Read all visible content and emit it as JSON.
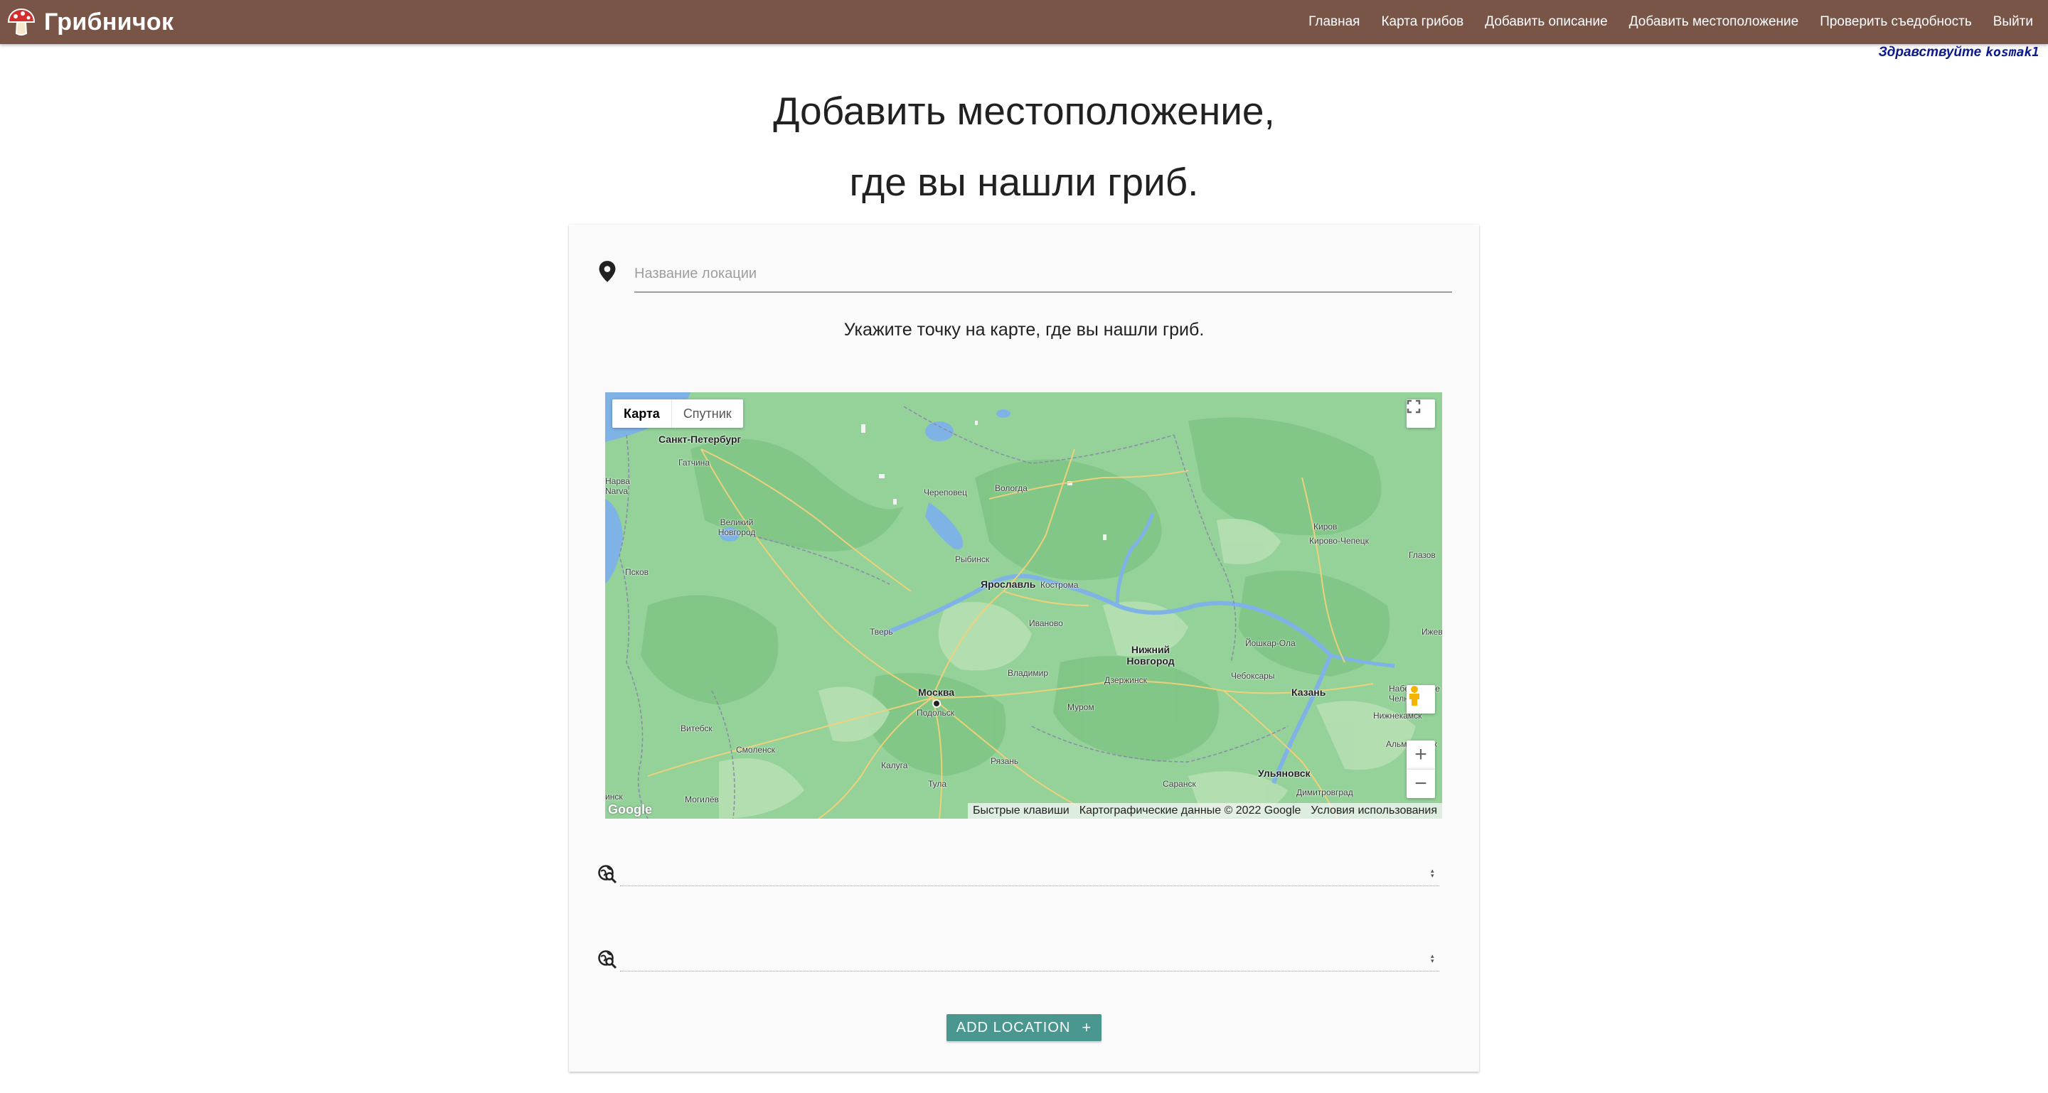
{
  "navbar": {
    "brand": "Грибничок",
    "brand_icon": "mushroom-icon",
    "links": [
      "Главная",
      "Карта грибов",
      "Добавить описание",
      "Добавить местоположение",
      "Проверить съедобность",
      "Выйти"
    ],
    "background": "#795548"
  },
  "greeting": {
    "prefix": "Здравствуйте",
    "username": "kosmak1"
  },
  "title": {
    "line1": "Добавить местоположение,",
    "line2": "где вы нашли гриб."
  },
  "form": {
    "location_placeholder": "Название локации",
    "location_value": "",
    "location_icon": "place-icon",
    "hint": "Укажите точку на карте, где вы нашли гриб.",
    "latitude_value": "",
    "longitude_value": "",
    "coord_icon": "travel-explore-icon",
    "submit_label": "ADD LOCATION",
    "submit_icon": "+",
    "accent": "#4a978f"
  },
  "map": {
    "type_buttons": [
      "Карта",
      "Спутник"
    ],
    "active_type": "Карта",
    "google_logo": "Google",
    "attribution": [
      "Быстрые клавиши",
      "Картографические данные © 2022 Google",
      "Условия использования"
    ],
    "cities": {
      "spb": "Санкт-Петербург",
      "gatchina": "Гатчина",
      "narva": "Нарва Narva",
      "vnovgorod": "Великий Новгород",
      "pskov": "Псков",
      "cherepovets": "Череповец",
      "vologda": "Вологда",
      "rybinsk": "Рыбинск",
      "yaroslavl": "Ярославль",
      "kostroma": "Кострома",
      "ivanovo": "Иваново",
      "tver": "Тверь",
      "moscow": "Москва",
      "podolsk": "Подольск",
      "vladimir": "Владимир",
      "nnovgorod": "Нижний Новгород",
      "dzerzhinsk": "Дзержинск",
      "murom": "Муром",
      "kirov": "Киров",
      "kirovochepetsk": "Кирово-Чепецк",
      "glazov": "Глазов",
      "izhevsk": "Ижев",
      "yoshkarola": "Йошкар-Ола",
      "cheboksary": "Чебоксары",
      "kazan": "Казань",
      "nchelny": "Набережные Челны",
      "nizhnekamsk": "Нижнекамск",
      "almetyevsk": "Альметьевск",
      "ulyanovsk": "Ульяновск",
      "dimitrovgrad": "Димитровград",
      "saransk": "Саранск",
      "ryazan": "Рязань",
      "kaluga": "Калуга",
      "tula": "Тула",
      "smolensk": "Смоленск",
      "vitebsk": "Витебск",
      "mogilev": "Могилёв",
      "minsk": "инск"
    }
  }
}
